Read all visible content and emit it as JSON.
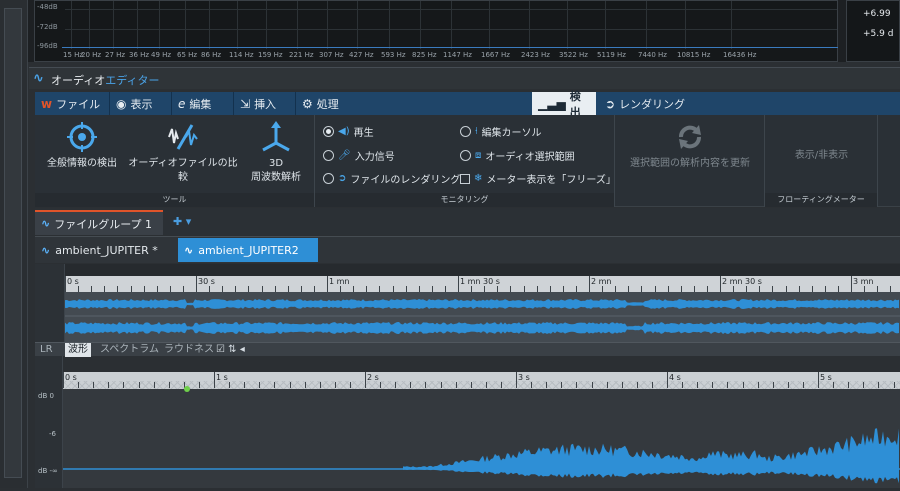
{
  "analyzer": {
    "db_labels": [
      "-48dB",
      "-72dB",
      "-96dB"
    ],
    "hz_labels": [
      "15 Hz",
      "20 Hz",
      "27 Hz",
      "36 Hz",
      "49 Hz",
      "65 Hz",
      "86 Hz",
      "114 Hz",
      "159 Hz",
      "221 Hz",
      "307 Hz",
      "427 Hz",
      "593 Hz",
      "825 Hz",
      "1147 Hz",
      "1667 Hz",
      "2423 Hz",
      "3522 Hz",
      "5119 Hz",
      "7440 Hz",
      "10815 Hz",
      "16436 Hz"
    ],
    "meter_values": [
      "+6.99",
      "+5.9 d"
    ]
  },
  "audio_editor": {
    "title_part1": "オーディオ",
    "title_part2": "エディター"
  },
  "ribbon_tabs": [
    {
      "label": "ファイル",
      "icon": "w-logo-icon"
    },
    {
      "label": "表示",
      "icon": "eye-icon"
    },
    {
      "label": "編集",
      "icon": "edit-icon"
    },
    {
      "label": "挿入",
      "icon": "insert-icon"
    },
    {
      "label": "処理",
      "icon": "process-icon"
    },
    {
      "label": "検出",
      "icon": "bars-icon"
    },
    {
      "label": "レンダリング",
      "icon": "render-icon"
    }
  ],
  "ribbon": {
    "tool_group": {
      "label": "ツール",
      "general_info": "全般情報の検出",
      "compare_files": "オーディオファイルの比較",
      "analysis_3d_line1": "3D",
      "analysis_3d_line2": "周波数解析"
    },
    "monitoring_group": {
      "label": "モニタリング",
      "playback": "再生",
      "input_signal": "入力信号",
      "file_rendering": "ファイルのレンダリング",
      "edit_cursor": "編集カーソル",
      "audio_selection": "オーディオ選択範囲",
      "freeze_meter": "メーター表示を「フリーズ」"
    },
    "update_analysis": "選択範囲の解析内容を更新",
    "floating_group": {
      "label": "フローティングメーター",
      "toggle": "表示/非表示"
    }
  },
  "file_group": {
    "tab_label": "ファイルグループ 1"
  },
  "file_tabs": [
    {
      "label": "ambient_JUPITER *"
    },
    {
      "label": "ambient_JUPITER2"
    }
  ],
  "overview": {
    "channel_label": "LR",
    "time_labels": [
      "0 s",
      "30 s",
      "1 mn",
      "1 mn 30 s",
      "2 mn",
      "2 mn 30 s",
      "3 mn"
    ]
  },
  "view_tabs": [
    "波形",
    "スペクトラム",
    "ラウドネス"
  ],
  "main": {
    "time_labels": [
      "0 s",
      "1 s",
      "2 s",
      "3 s",
      "4 s",
      "5 s"
    ],
    "db_labels": [
      "dB 0",
      "-6",
      "dB -∞"
    ]
  }
}
